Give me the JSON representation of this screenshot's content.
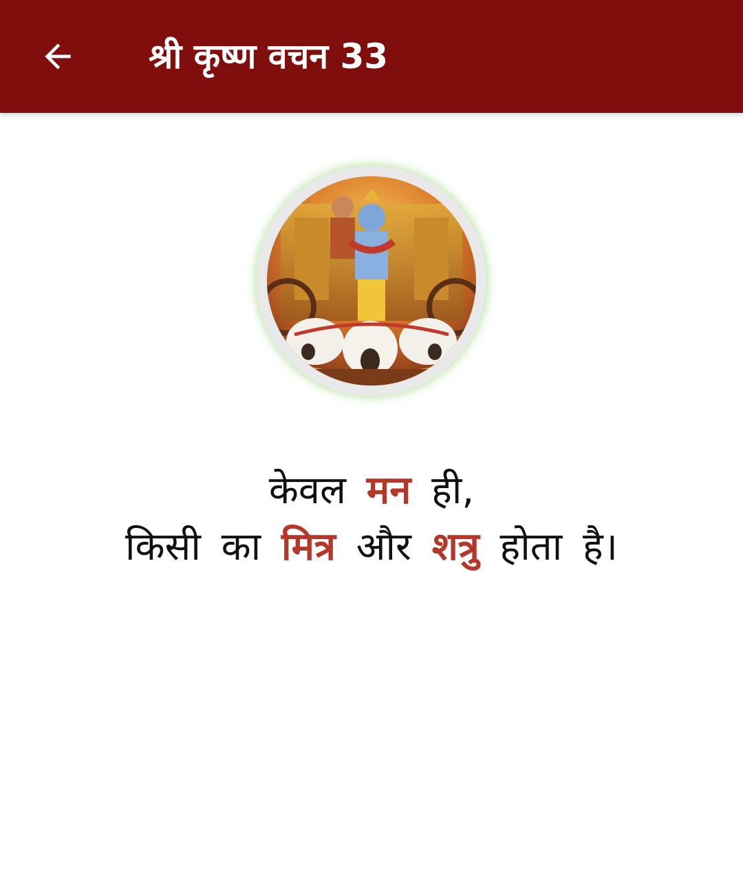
{
  "appbar": {
    "title": "श्री कृष्ण वचन 33",
    "back_icon": "arrow-left-icon",
    "background_color": "#7f0e0d"
  },
  "image": {
    "icon": "krishna-chariot-image"
  },
  "quote": {
    "line1": {
      "w1": "केवल",
      "w2": "मन",
      "w3": "ही,"
    },
    "line2": {
      "w1": "किसी",
      "w2": "का",
      "w3": "मित्र",
      "w4": "और",
      "w5": "शत्रु",
      "w6": "होता",
      "w7": "है।"
    },
    "highlight_color": "#b5372a"
  }
}
